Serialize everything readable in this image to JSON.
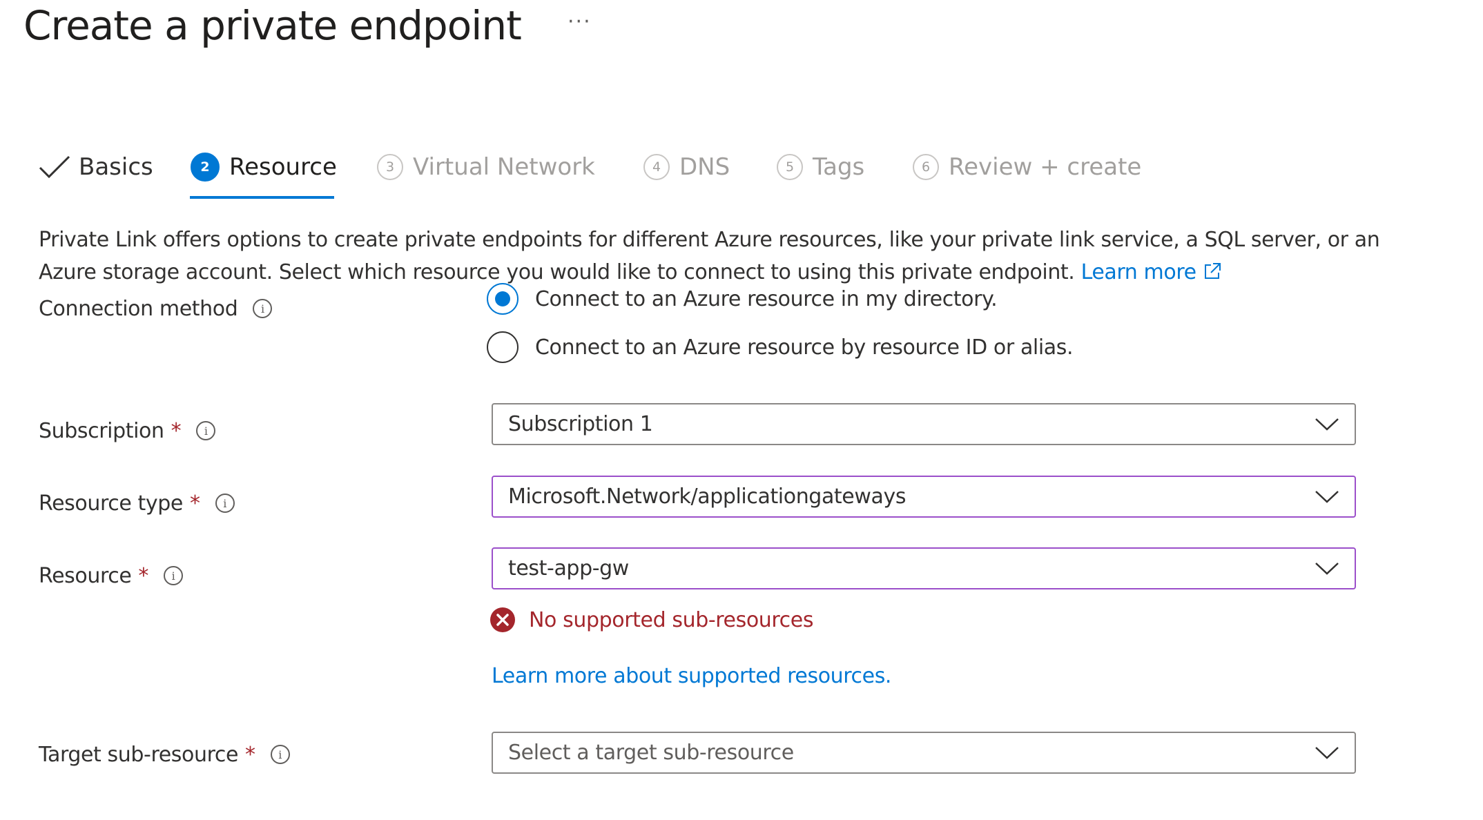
{
  "header": {
    "title": "Create a private endpoint",
    "more_label": "···"
  },
  "tabs": [
    {
      "label": "Basics",
      "state": "completed",
      "icon": "checkmark-icon"
    },
    {
      "label": "Resource",
      "number": "2",
      "state": "active"
    },
    {
      "label": "Virtual Network",
      "number": "3",
      "state": "disabled"
    },
    {
      "label": "DNS",
      "number": "4",
      "state": "disabled"
    },
    {
      "label": "Tags",
      "number": "5",
      "state": "disabled"
    },
    {
      "label": "Review + create",
      "number": "6",
      "state": "disabled"
    }
  ],
  "description": {
    "text": "Private Link offers options to create private endpoints for different Azure resources, like your private link service, a SQL server, or an Azure storage account. Select which resource you would like to connect to using this private endpoint.",
    "learn_more": "Learn more",
    "learn_more_icon": "external-link-icon"
  },
  "form": {
    "connection_method": {
      "label": "Connection method",
      "options": [
        {
          "label": "Connect to an Azure resource in my directory.",
          "selected": true
        },
        {
          "label": "Connect to an Azure resource by resource ID or alias.",
          "selected": false
        }
      ]
    },
    "subscription": {
      "label": "Subscription",
      "required": "*",
      "value": "Subscription 1"
    },
    "resource_type": {
      "label": "Resource type",
      "required": "*",
      "value": "Microsoft.Network/applicationgateways"
    },
    "resource": {
      "label": "Resource",
      "required": "*",
      "value": "test-app-gw"
    },
    "resource_error": "No supported sub-resources",
    "learn_more_supported": "Learn more about supported resources.",
    "target_sub_resource": {
      "label": "Target sub-resource",
      "required": "*",
      "placeholder": "Select a target sub-resource"
    },
    "info_glyph": "i"
  },
  "colors": {
    "accent": "#0078d4",
    "error": "#a4262c",
    "invalid_border": "#9b4fca",
    "disabled_text": "#a19f9d",
    "text": "#323130"
  }
}
